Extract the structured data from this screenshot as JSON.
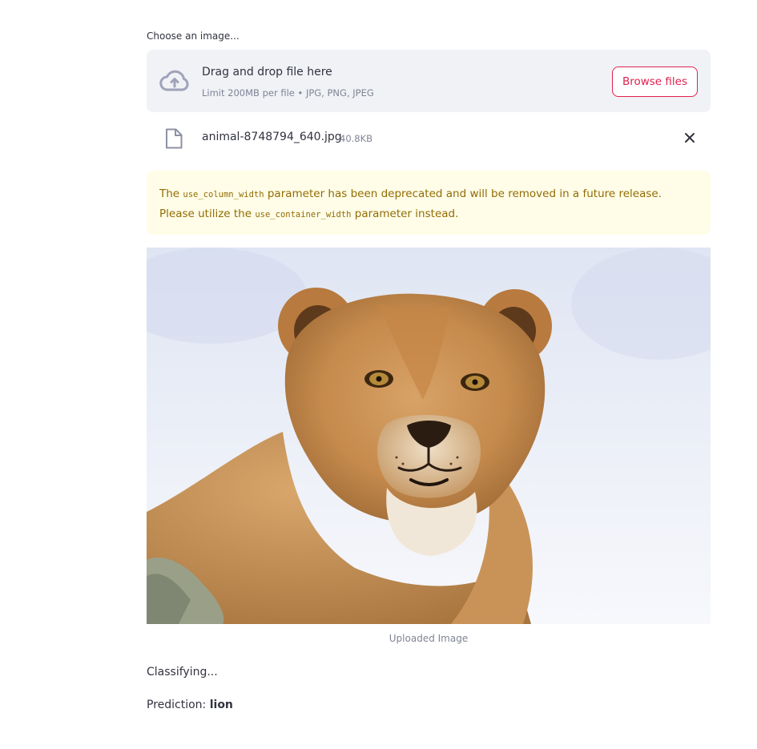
{
  "uploader": {
    "label": "Choose an image...",
    "dropzone_title": "Drag and drop file here",
    "dropzone_limit": "Limit 200MB per file • JPG, PNG, JPEG",
    "browse_label": "Browse files",
    "accent_color": "#e0214f"
  },
  "file": {
    "name": "animal-8748794_640.jpg",
    "size": "40.8KB"
  },
  "warning": {
    "text_1": "The ",
    "code_1": "use_column_width",
    "text_2": " parameter has been deprecated and will be removed in a future release. Please utilize the ",
    "code_2": "use_container_width",
    "text_3": " parameter instead.",
    "background": "#fffde7",
    "text_color": "#926c05"
  },
  "image": {
    "caption": "Uploaded Image"
  },
  "result": {
    "status": "Classifying...",
    "prediction_label": "Prediction: ",
    "prediction_value": "lion"
  }
}
